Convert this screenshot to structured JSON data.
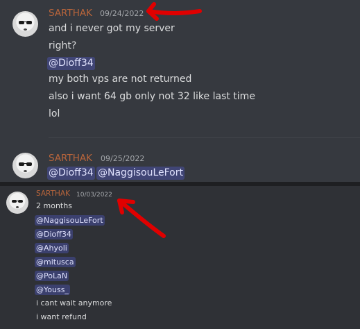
{
  "top_message_1": {
    "username": "SARTHAK",
    "timestamp": "09/24/2022",
    "lines": [
      "and i never got my server",
      "right?",
      "@Dioff34",
      "my both vps are not returned",
      "also i want 64 gb only not 32 like last time",
      "lol"
    ]
  },
  "top_message_2": {
    "username": "SARTHAK",
    "timestamp": "09/25/2022",
    "mentions": [
      "@Dioff34",
      "@NaggisouLeFort"
    ]
  },
  "bottom_message": {
    "username": "SARTHAK",
    "timestamp": "10/03/2022",
    "lines": [
      "2 months",
      "@NaggisouLeFort",
      "@Dioff34",
      "@Ahyoli",
      "@mitusca",
      "@PoLaN",
      "@Youss_",
      "i cant wait anymore",
      "i want refund"
    ]
  },
  "colors": {
    "username": "#b9653b",
    "mention_bg": "#4a4f8a",
    "annotation_arrow": "#e00000"
  },
  "icons": [
    "avatar-sunglasses",
    "red-arrow-annotation"
  ]
}
